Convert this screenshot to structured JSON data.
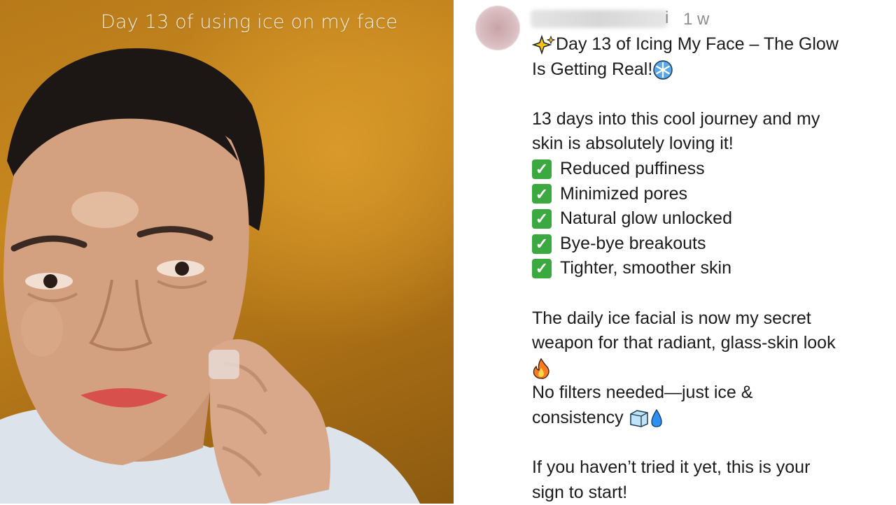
{
  "video": {
    "caption": "Day 13 of using ice on my face"
  },
  "post": {
    "username_tail": "i",
    "timestamp": "1 w",
    "title_line1": "Day 13 of Icing My Face – The Glow",
    "title_line2": "Is Getting Real!",
    "intro_line1": "13 days into this cool journey and my",
    "intro_line2": "skin is absolutely loving it!",
    "benefits": [
      "Reduced puffiness",
      "Minimized pores",
      "Natural glow unlocked",
      "Bye-bye breakouts",
      "Tighter, smoother skin"
    ],
    "secret_line1": "The daily ice facial is now my secret",
    "secret_line2": "weapon for that radiant, glass-skin look",
    "nofilters_line1": "No filters needed—just ice &",
    "nofilters_line2": "consistency",
    "cta_line1": "If you haven’t tried it yet, this is your",
    "cta_line2": "sign to start!"
  },
  "icons": [
    "sparkles-emoji",
    "snowflake-emoji",
    "check-mark-emoji",
    "fire-emoji",
    "ice-cube-emoji",
    "droplet-emoji"
  ],
  "colors": {
    "background_video": "#c8881f",
    "check_green": "#3ba93f",
    "text": "#1b1b1b",
    "meta_gray": "#8e8e8e"
  }
}
